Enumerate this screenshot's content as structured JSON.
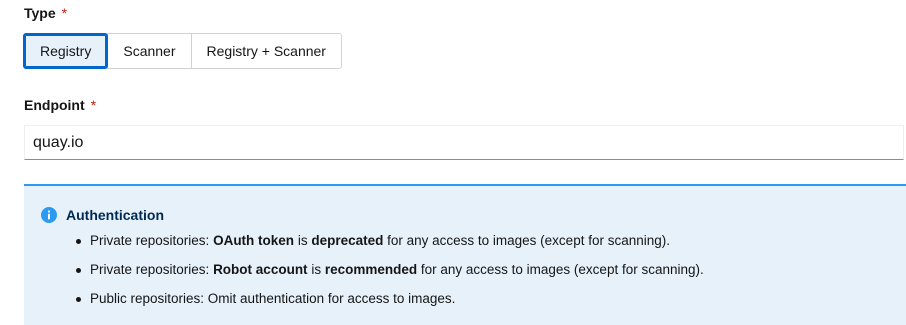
{
  "type_field": {
    "label": "Type",
    "required_marker": "*",
    "options": [
      "Registry",
      "Scanner",
      "Registry + Scanner"
    ],
    "selected": "Registry"
  },
  "endpoint_field": {
    "label": "Endpoint",
    "required_marker": "*",
    "value": "quay.io"
  },
  "alert": {
    "icon": "info-icon",
    "title": "Authentication",
    "items": [
      {
        "prefix": "Private repositories: ",
        "bold1": "OAuth token",
        "middle": " is ",
        "bold2": "deprecated",
        "suffix": " for any access to images (except for scanning)."
      },
      {
        "prefix": "Private repositories: ",
        "bold1": "Robot account",
        "middle": " is ",
        "bold2": "recommended",
        "suffix": " for any access to images (except for scanning)."
      },
      {
        "text": "Public repositories: Omit authentication for access to images."
      }
    ]
  },
  "colors": {
    "accent": "#0066cc",
    "required": "#c9190b",
    "alert_bg": "#e7f1fa",
    "alert_border": "#2b9af3"
  }
}
